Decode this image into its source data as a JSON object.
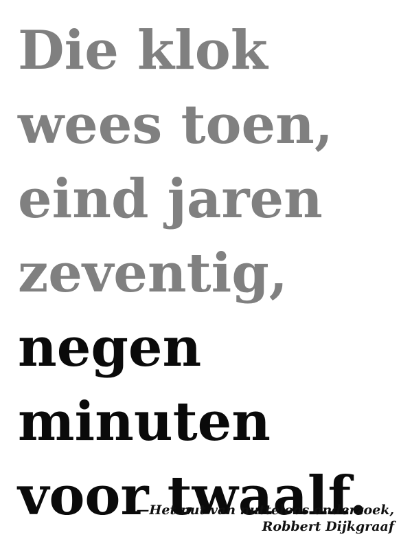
{
  "quote": {
    "grey_lines": [
      "Die klok",
      "wees toen,",
      "eind jaren",
      "zeventig,"
    ],
    "black_lines": [
      "negen",
      "minuten",
      "voor twaalf."
    ]
  },
  "attribution": {
    "line1": "—Het nut van nutteloos onderzoek,",
    "line2": "Robbert Dijkgraaf"
  },
  "colors": {
    "grey_text": "#808080",
    "black_text": "#0a0a0a",
    "background": "#ffffff"
  }
}
